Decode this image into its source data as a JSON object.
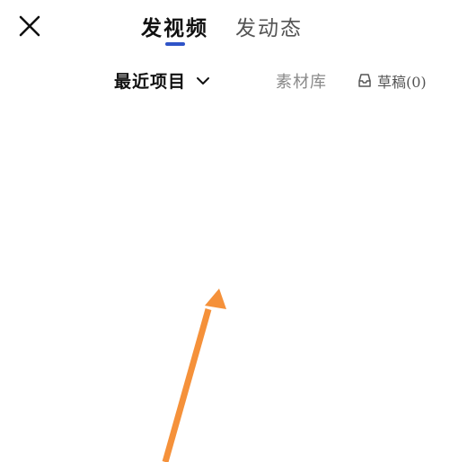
{
  "header": {
    "close_icon": "close-icon"
  },
  "tabs": [
    {
      "label": "发视频",
      "active": true
    },
    {
      "label": "发动态",
      "active": false
    }
  ],
  "accent_color": "#2f54c8",
  "subbar": {
    "recent_label": "最近项目",
    "recent_icon": "chevron-down-icon",
    "library_label": "素材库",
    "drafts_icon": "drafts-box-icon",
    "drafts_label": "草稿(0)"
  },
  "annotation": {
    "arrow_color": "#f5913a"
  }
}
